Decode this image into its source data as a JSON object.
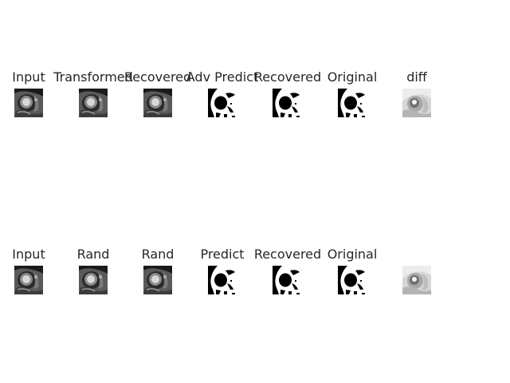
{
  "rows": [
    {
      "panels": [
        {
          "title": "Input",
          "kind": "mri"
        },
        {
          "title": "Transformed",
          "kind": "mri"
        },
        {
          "title": "Recovered",
          "kind": "mri"
        },
        {
          "title": "Adv Predict",
          "kind": "mask"
        },
        {
          "title": "Recovered",
          "kind": "mask"
        },
        {
          "title": "Original",
          "kind": "mask"
        },
        {
          "title": "diff",
          "kind": "diff"
        }
      ]
    },
    {
      "panels": [
        {
          "title": "Input",
          "kind": "mri"
        },
        {
          "title": "Rand",
          "kind": "mri"
        },
        {
          "title": "Rand",
          "kind": "mri"
        },
        {
          "title": "Predict",
          "kind": "mask"
        },
        {
          "title": "Recovered",
          "kind": "mask"
        },
        {
          "title": "Original",
          "kind": "mask"
        },
        {
          "title": "",
          "kind": "diff"
        }
      ]
    }
  ]
}
